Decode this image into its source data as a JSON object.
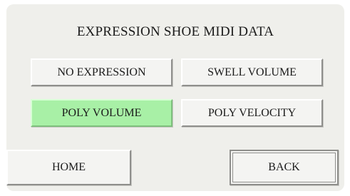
{
  "screen": {
    "title": "EXPRESSION SHOE MIDI DATA"
  },
  "options": {
    "no_expression": "NO EXPRESSION",
    "swell_volume": "SWELL VOLUME",
    "poly_volume": "POLY VOLUME",
    "poly_velocity": "POLY VELOCITY",
    "selected": "POLY VOLUME"
  },
  "nav": {
    "home": "HOME",
    "back": "BACK"
  },
  "colors": {
    "panel": "#efefeb",
    "selected_button": "#a8f0a6",
    "button": "#f4f4f2"
  }
}
